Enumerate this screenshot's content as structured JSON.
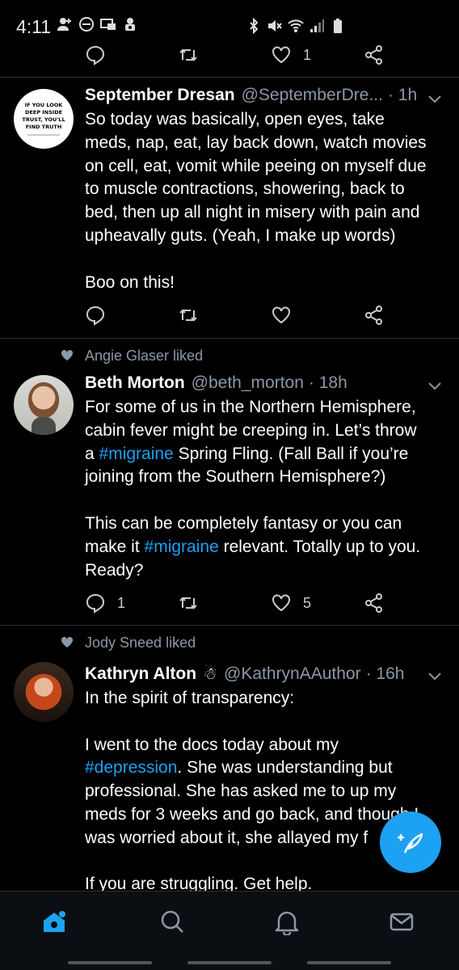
{
  "status_bar": {
    "time": "4:11"
  },
  "top_action_bar": {
    "like_count": "1"
  },
  "tweets": [
    {
      "avatar_text": "IF YOU LOOK DEEP INSIDE TRUST, YOU'LL FIND TRUTH",
      "name": "September Dresan",
      "handle": "@SeptemberDre...",
      "time": "· 1h",
      "lines": [
        "So today was basically, open eyes, take",
        "meds, nap, eat, lay back down, watch movies",
        "on cell, eat, vomit while peeing on myself due",
        "to muscle contractions, showering, back to",
        "bed, then up all night in misery with pain and",
        "upheavally guts. (Yeah, I make up words)"
      ],
      "line2": "Boo on this!",
      "reply_count": "",
      "like_count": ""
    },
    {
      "liked_by": "Angie Glaser liked",
      "name": "Beth Morton",
      "handle": "@beth_morton",
      "time": "· 18h",
      "p1_a": "For some of us in the Northern Hemisphere,",
      "p1_b": "cabin fever might be creeping in. Let’s throw",
      "p1_c_pre": "a ",
      "p1_c_tag": "#migraine",
      "p1_c_post": " Spring Fling. (Fall Ball if you’re",
      "p1_d": "joining from the Southern Hemisphere?)",
      "p2_a": "This can be completely fantasy or you can",
      "p2_b_pre": "make it ",
      "p2_b_tag": "#migraine",
      "p2_b_post": " relevant. Totally up to you.",
      "p2_c": "Ready?",
      "reply_count": "1",
      "like_count": "5"
    },
    {
      "liked_by": "Jody Sneed liked",
      "name": "Kathryn Alton",
      "name_emoji": "snowman-icon",
      "handle": "@KathrynAAuthor",
      "time": "· 16h",
      "l1": "In the spirit of transparency:",
      "l2": "I went to the docs today about my",
      "l3_tag": "#depression",
      "l3_post": ". She was understanding but",
      "l4": "professional. She has asked me to up my",
      "l5": "meds for 3 weeks and go back, and though I",
      "l6": "was worried about it, she allayed my f",
      "l7": "If you are struggling. Get help."
    }
  ],
  "colors": {
    "accent": "#1da1f2",
    "secondary_text": "#8b98a5",
    "background": "#000000"
  }
}
